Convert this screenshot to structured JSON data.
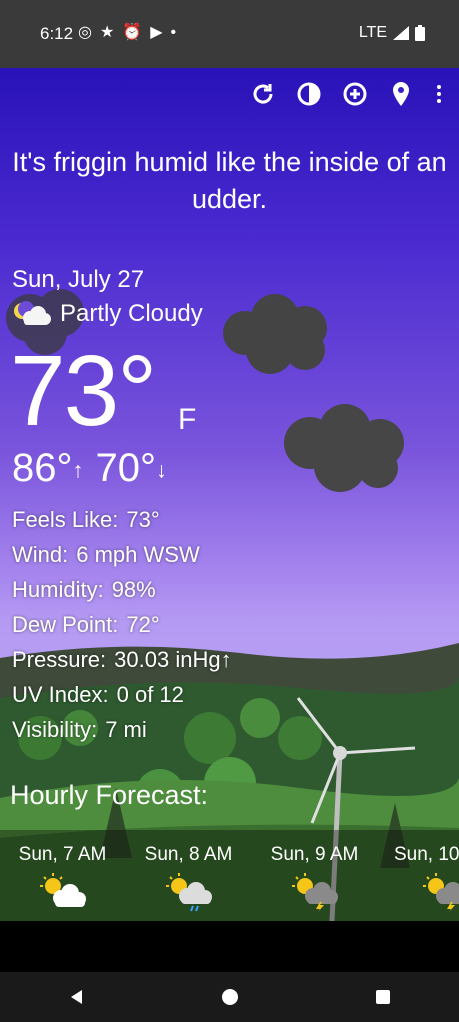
{
  "status": {
    "time": "6:12",
    "network": "LTE",
    "icons": [
      "instagram-icon",
      "star-icon",
      "alarm-icon",
      "youtube-icon",
      "dot-icon"
    ]
  },
  "toolbar": {
    "icons": [
      "refresh-icon",
      "theme-icon",
      "add-location-icon",
      "location-pin-icon",
      "overflow-menu-icon"
    ]
  },
  "tagline": "It's friggin humid like the inside of an udder.",
  "current": {
    "date": "Sun, July 27",
    "condition": "Partly Cloudy",
    "temp": "73°",
    "unit": "F",
    "high": "86°",
    "low": "70°",
    "details": [
      {
        "label": "Feels Like:",
        "value": "73°"
      },
      {
        "label": "Wind:",
        "value": "6 mph WSW"
      },
      {
        "label": "Humidity:",
        "value": "98%"
      },
      {
        "label": "Dew Point:",
        "value": "72°"
      },
      {
        "label": "Pressure:",
        "value": "30.03 inHg↑"
      },
      {
        "label": "UV Index:",
        "value": "0 of 12"
      },
      {
        "label": "Visibility:",
        "value": "7 mi"
      }
    ]
  },
  "hourly": {
    "title": "Hourly Forecast:",
    "items": [
      {
        "time": "Sun, 7 AM",
        "icon": "partly-sunny-icon"
      },
      {
        "time": "Sun, 8 AM",
        "icon": "sun-cloud-rain-icon"
      },
      {
        "time": "Sun, 9 AM",
        "icon": "sun-cloud-thunder-icon"
      },
      {
        "time": "Sun, 10",
        "icon": "sun-cloud-thunder-icon"
      }
    ]
  }
}
